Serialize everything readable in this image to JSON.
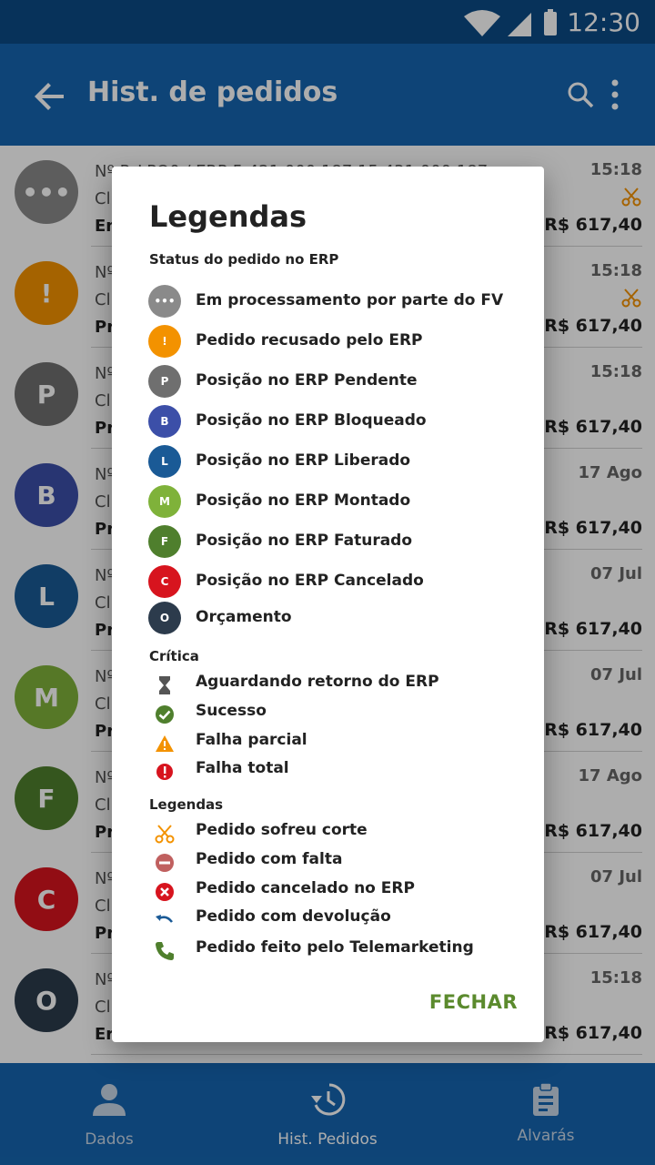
{
  "status_bar": {
    "time": "12:30"
  },
  "app_bar": {
    "title": "Hist. de pedidos"
  },
  "list": {
    "rows": [
      {
        "avatar": "•••",
        "color": "#8a8a8a",
        "line1": "Nº P. LPO0 / ERP 5 421.000.187.15.431.000.187",
        "line2": "Cl",
        "line3": "Em",
        "date": "15:18",
        "price": "R$ 617,40",
        "cut": true
      },
      {
        "avatar": "!",
        "color": "#f39200",
        "line1": "Nº",
        "line2": "Cl",
        "line3": "Pr",
        "date": "15:18",
        "price": "R$ 617,40",
        "cut": true
      },
      {
        "avatar": "P",
        "color": "#6f6f6f",
        "line1": "Nº",
        "line2": "Cl",
        "line3": "Pr",
        "date": "15:18",
        "price": "R$ 617,40",
        "cut": false
      },
      {
        "avatar": "B",
        "color": "#3c4fa8",
        "line1": "Nº",
        "line2": "Cl",
        "line3": "Pr",
        "date": "17 Ago",
        "price": "R$ 617,40",
        "cut": false
      },
      {
        "avatar": "L",
        "color": "#1a5a96",
        "line1": "Nº",
        "line2": "Cl",
        "line3": "Pr",
        "date": "07 Jul",
        "price": "R$ 617,40",
        "cut": false
      },
      {
        "avatar": "M",
        "color": "#7fb23a",
        "line1": "Nº",
        "line2": "Cl",
        "line3": "Pr",
        "date": "07 Jul",
        "price": "R$ 617,40",
        "cut": false
      },
      {
        "avatar": "F",
        "color": "#4f7f2d",
        "line1": "Nº",
        "line2": "Cl",
        "line3": "Pr",
        "date": "17 Ago",
        "price": "R$ 617,40",
        "cut": false
      },
      {
        "avatar": "C",
        "color": "#d7141e",
        "line1": "Nº",
        "line2": "Cl",
        "line3": "Pr",
        "date": "07 Jul",
        "price": "R$ 617,40",
        "cut": false
      },
      {
        "avatar": "O",
        "color": "#2c3b4c",
        "line1": "Nº",
        "line2": "Cl",
        "line3": "Er",
        "date": "15:18",
        "price": "R$ 617,40",
        "cut": false
      }
    ]
  },
  "bottom_nav": {
    "items": [
      {
        "label": "Dados",
        "icon": "person-icon",
        "active": false
      },
      {
        "label": "Hist. Pedidos",
        "icon": "history-icon",
        "active": true
      },
      {
        "label": "Alvarás",
        "icon": "clipboard-icon",
        "active": false
      }
    ]
  },
  "dialog": {
    "title": "Legendas",
    "status_section": "Status do pedido no ERP",
    "status_items": [
      {
        "badge": "•••",
        "color": "#8a8a8a",
        "label": "Em processamento por parte do FV"
      },
      {
        "badge": "!",
        "color": "#f39200",
        "label": "Pedido recusado pelo ERP"
      },
      {
        "badge": "P",
        "color": "#6f6f6f",
        "label": "Posição no ERP Pendente"
      },
      {
        "badge": "B",
        "color": "#3c4fa8",
        "label": "Posição no ERP Bloqueado"
      },
      {
        "badge": "L",
        "color": "#1a5a96",
        "label": "Posição no ERP Liberado"
      },
      {
        "badge": "M",
        "color": "#7fb23a",
        "label": "Posição no ERP Montado"
      },
      {
        "badge": "F",
        "color": "#4f7f2d",
        "label": "Posição no ERP Faturado"
      },
      {
        "badge": "C",
        "color": "#d7141e",
        "label": "Posição no ERP Cancelado"
      },
      {
        "badge": "O",
        "color": "#2c3b4c",
        "label": "Orçamento"
      }
    ],
    "critica_section": "Crítica",
    "critica_items": [
      {
        "icon": "hourglass-icon",
        "label": "Aguardando retorno do ERP"
      },
      {
        "icon": "check-circle-icon",
        "label": "Sucesso"
      },
      {
        "icon": "warning-icon",
        "label": "Falha parcial"
      },
      {
        "icon": "error-icon",
        "label": "Falha total"
      }
    ],
    "legend_section": "Legendas",
    "legend_items": [
      {
        "icon": "scissors-icon",
        "label": "Pedido sofreu corte"
      },
      {
        "icon": "minus-circle-icon",
        "label": "Pedido com falta"
      },
      {
        "icon": "cancel-circle-icon",
        "label": "Pedido cancelado no ERP"
      },
      {
        "icon": "undo-icon",
        "label": "Pedido com devolução"
      },
      {
        "icon": "phone-icon",
        "label": "Pedido feito pelo Telemarketing"
      }
    ],
    "close_label": "FECHAR"
  },
  "colors": {
    "primary": "#1565b0",
    "primary_dark": "#0b4a85",
    "action_green": "#5b8a2d",
    "scissors_orange": "#f39200"
  }
}
